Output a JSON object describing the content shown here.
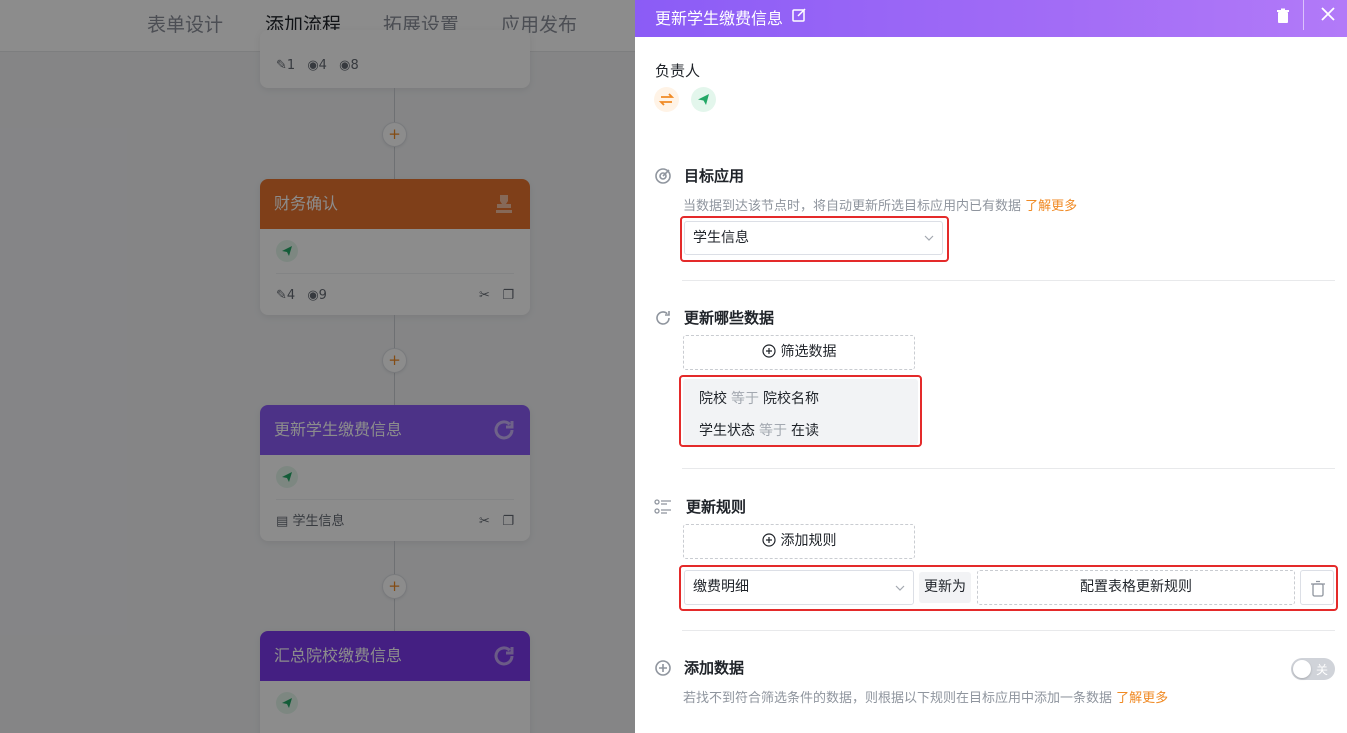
{
  "topnav": {
    "tabs": [
      "表单设计",
      "添加流程",
      "拓展设置",
      "应用发布"
    ],
    "active_index": 1
  },
  "flow": {
    "top_node": {
      "edit_count": "1",
      "view_count": "4",
      "view2_count": "8"
    },
    "nodes": [
      {
        "title": "财务确认",
        "edit_count": "4",
        "view_count": "9",
        "color": "#e8742e"
      },
      {
        "title": "更新学生缴费信息",
        "footer_text": "学生信息",
        "color": "#8b5cf6"
      },
      {
        "title": "汇总院校缴费信息",
        "color": "#7c3aed"
      }
    ],
    "add_symbol": "+"
  },
  "drawer": {
    "title": "更新学生缴费信息",
    "owner_label": "负责人",
    "target_app": {
      "title": "目标应用",
      "hint": "当数据到达该节点时，将自动更新所选目标应用内已有数据",
      "hint_link": "了解更多",
      "selected": "学生信息"
    },
    "which_data": {
      "title": "更新哪些数据",
      "filter_button": "筛选数据",
      "conditions": [
        {
          "field": "院校",
          "op": "等于",
          "value": "院校名称"
        },
        {
          "field": "学生状态",
          "op": "等于",
          "value": "在读"
        }
      ]
    },
    "rules": {
      "title": "更新规则",
      "add_button": "添加规则",
      "field_selected": "缴费明细",
      "update_to": "更新为",
      "config_button": "配置表格更新规则"
    },
    "add_data": {
      "title": "添加数据",
      "hint": "若找不到符合筛选条件的数据，则根据以下规则在目标应用中添加一条数据",
      "hint_link": "了解更多",
      "toggle_text": "关",
      "toggle_on": false
    }
  },
  "colors": {
    "accent": "#f08a24",
    "drawer_header": "#8b5cf6",
    "highlight_box": "#e42a2a"
  }
}
